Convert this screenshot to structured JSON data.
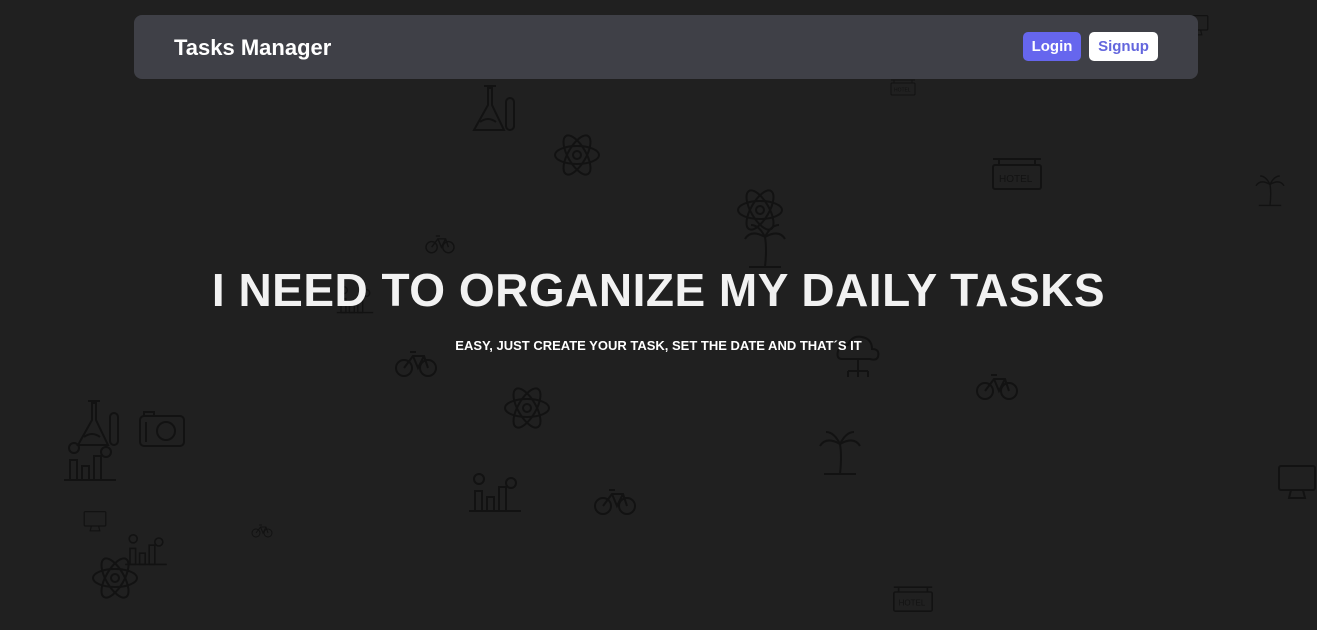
{
  "navbar": {
    "brand": "Tasks Manager",
    "login_label": "Login",
    "signup_label": "Signup"
  },
  "hero": {
    "title": "I NEED TO ORGANIZE MY DAILY TASKS",
    "subtitle": "EASY, JUST CREATE YOUR TASK, SET THE DATE AND THAT´S IT"
  },
  "background": {
    "icons": [
      "cloud-network-icon",
      "hotel-sign-icon",
      "flask-icon",
      "atom-icon",
      "palm-tree-icon",
      "bicycle-icon",
      "camera-icon",
      "bar-chart-icon",
      "monitor-icon"
    ]
  },
  "colors": {
    "page_bg": "#202020",
    "navbar_bg": "#3f4047",
    "accent": "#6666ee",
    "icon_stroke": "#111111"
  }
}
